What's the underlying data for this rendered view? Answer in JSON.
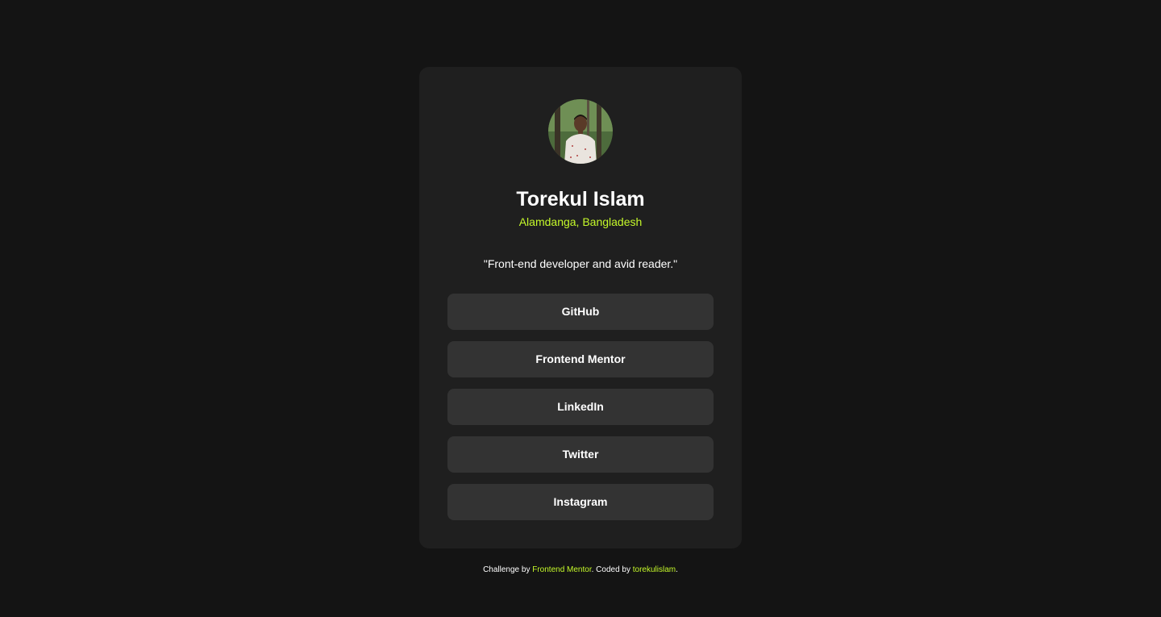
{
  "profile": {
    "name": "Torekul Islam",
    "location": "Alamdanga, Bangladesh",
    "bio": "\"Front-end developer and avid reader.\""
  },
  "links": [
    {
      "label": "GitHub"
    },
    {
      "label": "Frontend Mentor"
    },
    {
      "label": "LinkedIn"
    },
    {
      "label": "Twitter"
    },
    {
      "label": "Instagram"
    }
  ],
  "footer": {
    "prefix": "Challenge by ",
    "challenge_link": "Frontend Mentor",
    "middle": ". Coded by ",
    "author_link": "torekulislam",
    "suffix": "."
  },
  "colors": {
    "background": "#141414",
    "card": "#1f1f1f",
    "button": "#333333",
    "accent": "#c4f82a"
  }
}
